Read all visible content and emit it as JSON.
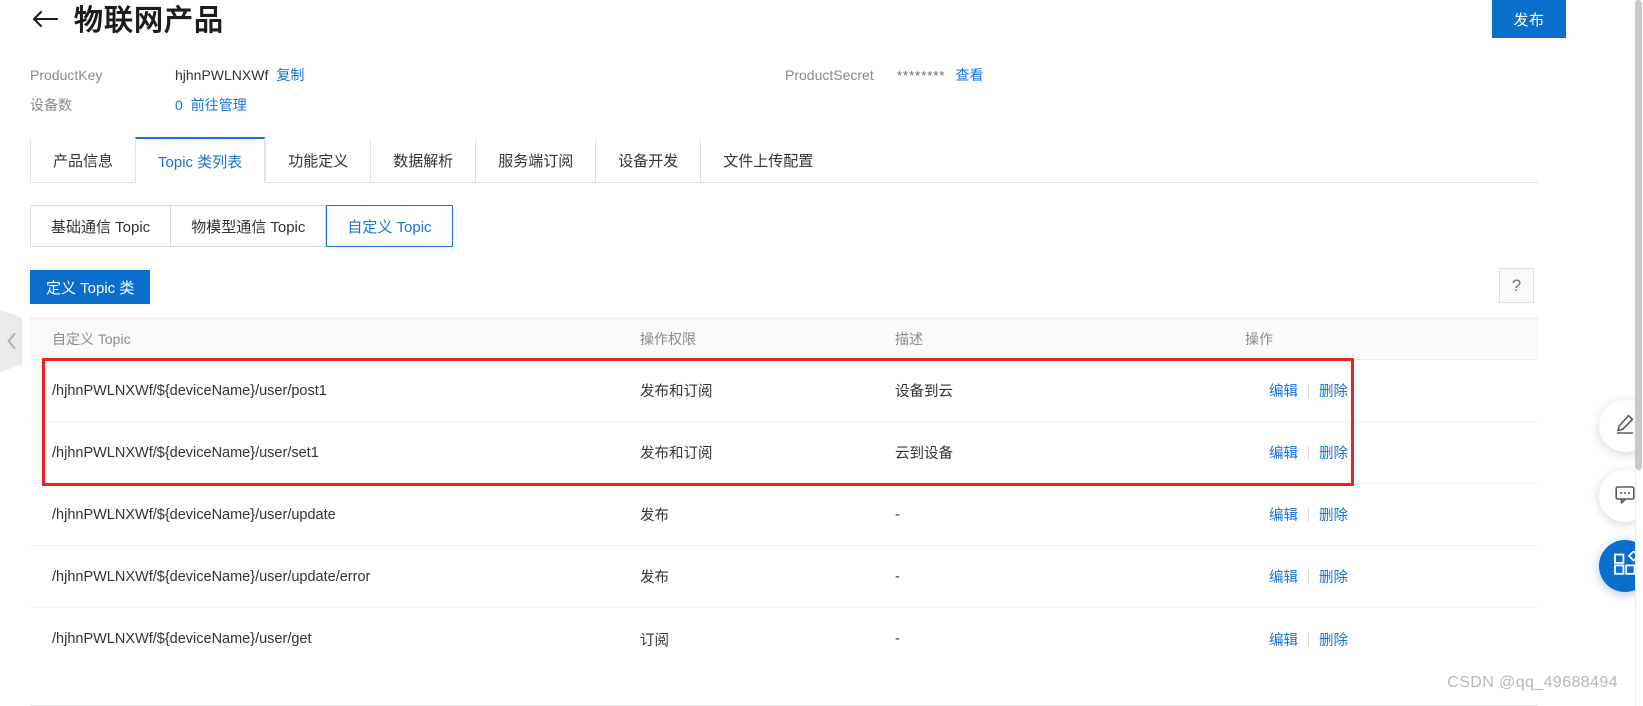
{
  "header": {
    "back_icon": "arrow-left-icon",
    "title": "物联网产品",
    "publish_label": "发布"
  },
  "meta": {
    "product_key_label": "ProductKey",
    "product_key_value": "hjhnPWLNXWf",
    "copy_label": "复制",
    "product_secret_label": "ProductSecret",
    "product_secret_value": "********",
    "view_label": "查看",
    "device_count_label": "设备数",
    "device_count_value": "0",
    "go_manage_label": "前往管理"
  },
  "tabs": [
    {
      "label": "产品信息",
      "active": false
    },
    {
      "label": "Topic 类列表",
      "active": true
    },
    {
      "label": "功能定义",
      "active": false
    },
    {
      "label": "数据解析",
      "active": false
    },
    {
      "label": "服务端订阅",
      "active": false
    },
    {
      "label": "设备开发",
      "active": false
    },
    {
      "label": "文件上传配置",
      "active": false
    }
  ],
  "subtabs": [
    {
      "label": "基础通信 Topic",
      "active": false
    },
    {
      "label": "物模型通信 Topic",
      "active": false
    },
    {
      "label": "自定义 Topic",
      "active": true
    }
  ],
  "toolbar": {
    "define_topic_label": "定义 Topic 类",
    "help_label": "?"
  },
  "table": {
    "columns": [
      "自定义 Topic",
      "操作权限",
      "描述",
      "操作"
    ],
    "edit_label": "编辑",
    "delete_label": "删除",
    "rows": [
      {
        "topic": "/hjhnPWLNXWf/${deviceName}/user/post1",
        "permission": "发布和订阅",
        "description": "设备到云",
        "highlighted": true
      },
      {
        "topic": "/hjhnPWLNXWf/${deviceName}/user/set1",
        "permission": "发布和订阅",
        "description": "云到设备",
        "highlighted": true
      },
      {
        "topic": "/hjhnPWLNXWf/${deviceName}/user/update",
        "permission": "发布",
        "description": "-",
        "highlighted": false
      },
      {
        "topic": "/hjhnPWLNXWf/${deviceName}/user/update/error",
        "permission": "发布",
        "description": "-",
        "highlighted": false
      },
      {
        "topic": "/hjhnPWLNXWf/${deviceName}/user/get",
        "permission": "订阅",
        "description": "-",
        "highlighted": false
      }
    ]
  },
  "floating_buttons": [
    {
      "icon": "pencil-icon",
      "style": "white"
    },
    {
      "icon": "chat-bubble-icon",
      "style": "white"
    },
    {
      "icon": "apps-grid-icon",
      "style": "blue"
    }
  ],
  "sidebar": {
    "collapse_icon": "chevron-left-icon"
  },
  "annotation": {
    "type": "red-rectangle",
    "covers_rows": [
      1,
      2
    ],
    "color": "#ef2020"
  },
  "watermark": "CSDN @qq_49688494",
  "colors": {
    "primary": "#0a6ecd",
    "link": "#1775d4",
    "annotation_red": "#ef2020",
    "header_bg": "#fafafa"
  }
}
